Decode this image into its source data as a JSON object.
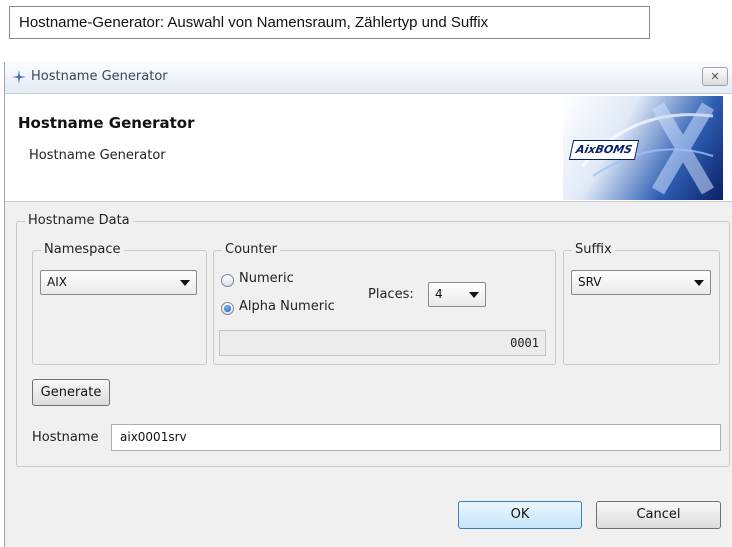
{
  "caption": "Hostname-Generator: Auswahl von Namensraum, Zählertyp und Suffix",
  "window": {
    "title": "Hostname Generator",
    "close_symbol": "✕"
  },
  "header": {
    "title": "Hostname Generator",
    "subtitle": "Hostname Generator",
    "logo_text": "AixBOMS"
  },
  "hostname_data": {
    "group_label": "Hostname Data",
    "namespace": {
      "label": "Namespace",
      "selected": "AIX"
    },
    "counter": {
      "label": "Counter",
      "options": [
        "Numeric",
        "Alpha Numeric"
      ],
      "selected": "Alpha Numeric",
      "places_label": "Places:",
      "places_value": "4",
      "counter_value": "0001"
    },
    "suffix": {
      "label": "Suffix",
      "selected": "SRV"
    },
    "generate_label": "Generate",
    "hostname_label": "Hostname",
    "hostname_value": "aix0001srv"
  },
  "buttons": {
    "ok": "OK",
    "cancel": "Cancel"
  },
  "colors": {
    "default_button_border": "#3c7fb1",
    "title_text": "#3a4656"
  }
}
